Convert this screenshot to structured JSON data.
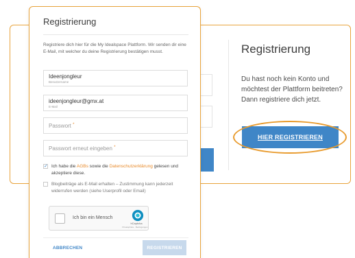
{
  "background_panel": {
    "title": "Registrierung",
    "text": "Du hast noch kein Konto und möchtest der Plattform beitreten? Dann registriere dich jetzt.",
    "register_button": "HIER REGISTRIEREN"
  },
  "modal": {
    "title": "Registrierung",
    "intro": "Registriere dich hier für die My Idealspace Plattform. Wir senden dir eine E-Mail, mit welcher du deine Registrierung bestätigen musst.",
    "fields": {
      "username": {
        "value": "Ideenjongleur",
        "sublabel": "Benutzername"
      },
      "email": {
        "value": "ideenjongleur@gmx.at",
        "sublabel": "E-Mail"
      },
      "password": {
        "placeholder": "Passwort"
      },
      "password_repeat": {
        "placeholder": "Passwort erneut eingeben"
      },
      "required_marker": "*"
    },
    "terms": {
      "prefix": "Ich habe die ",
      "agb": "AGBs",
      "middle": " sowie die ",
      "privacy": "Datenschutzerklärung",
      "suffix": " gelesen und akzeptiere diese.",
      "checked": true,
      "check_mark": "✓"
    },
    "newsletter": {
      "text": "Blogbeiträge als E-Mail erhalten – Zustimmung kann jederzeit widerrufen werden (siehe Userprofil oder Email)",
      "checked": false
    },
    "captcha": {
      "label": "Ich bin ein Mensch",
      "brand": "hCaptcha",
      "links": "Privatsphäre · Bedingungen"
    },
    "cancel_button": "ABBRECHEN",
    "submit_button": "REGISTRIEREN"
  },
  "colors": {
    "accent_orange": "#e8a23a",
    "button_blue": "#3f86c7",
    "disabled_blue": "#c7d9ec"
  }
}
